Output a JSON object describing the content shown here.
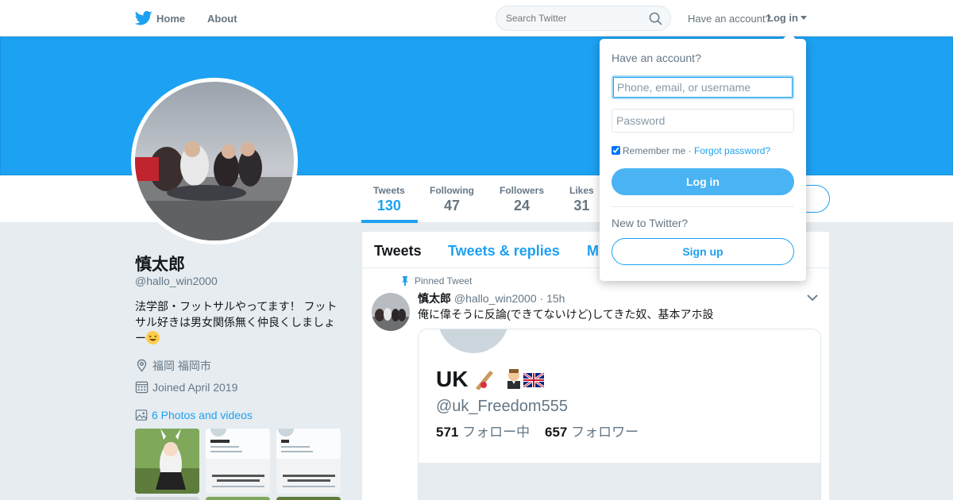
{
  "topbar": {
    "home_label": "Home",
    "about_label": "About",
    "search_placeholder": "Search Twitter",
    "have_account": "Have an account?",
    "login_label": "Log in"
  },
  "profile": {
    "name": "慎太郎",
    "handle": "@hallo_win2000",
    "bio_text": "法学部・フットサルやってます！ フットサル好きは男女関係無く仲良くしましょー",
    "bio_emoji": "grinning-squinting-face-icon",
    "location": "福岡 福岡市",
    "joined": "Joined April 2019",
    "photos_link": "6 Photos and videos"
  },
  "stats": [
    {
      "label": "Tweets",
      "value": "130"
    },
    {
      "label": "Following",
      "value": "47"
    },
    {
      "label": "Followers",
      "value": "24"
    },
    {
      "label": "Likes",
      "value": "31"
    }
  ],
  "timeline": {
    "tabs": [
      "Tweets",
      "Tweets & replies",
      "M"
    ],
    "pinned_label": "Pinned Tweet",
    "tweet": {
      "name": "慎太郎",
      "handle": "@hallo_win2000",
      "time": "· 15h",
      "text": "俺に偉そうに反論(できてないけど)してきた奴、基本アホ設"
    },
    "card": {
      "name": "UK",
      "handle": "@uk_Freedom555",
      "following_count": "571",
      "following_label": "フォロー中",
      "followers_count": "657",
      "followers_label": "フォロワー"
    }
  },
  "login_dropdown": {
    "title": "Have an account?",
    "username_placeholder": "Phone, email, or username",
    "password_placeholder": "Password",
    "remember_label": "Remember me ·",
    "forgot_label": "Forgot password?",
    "login_button": "Log in",
    "new_label": "New to Twitter?",
    "signup_button": "Sign up"
  },
  "colors": {
    "accent": "#1da1f2",
    "banner": "#1da1f2",
    "page_bg": "#e6ecf0"
  }
}
